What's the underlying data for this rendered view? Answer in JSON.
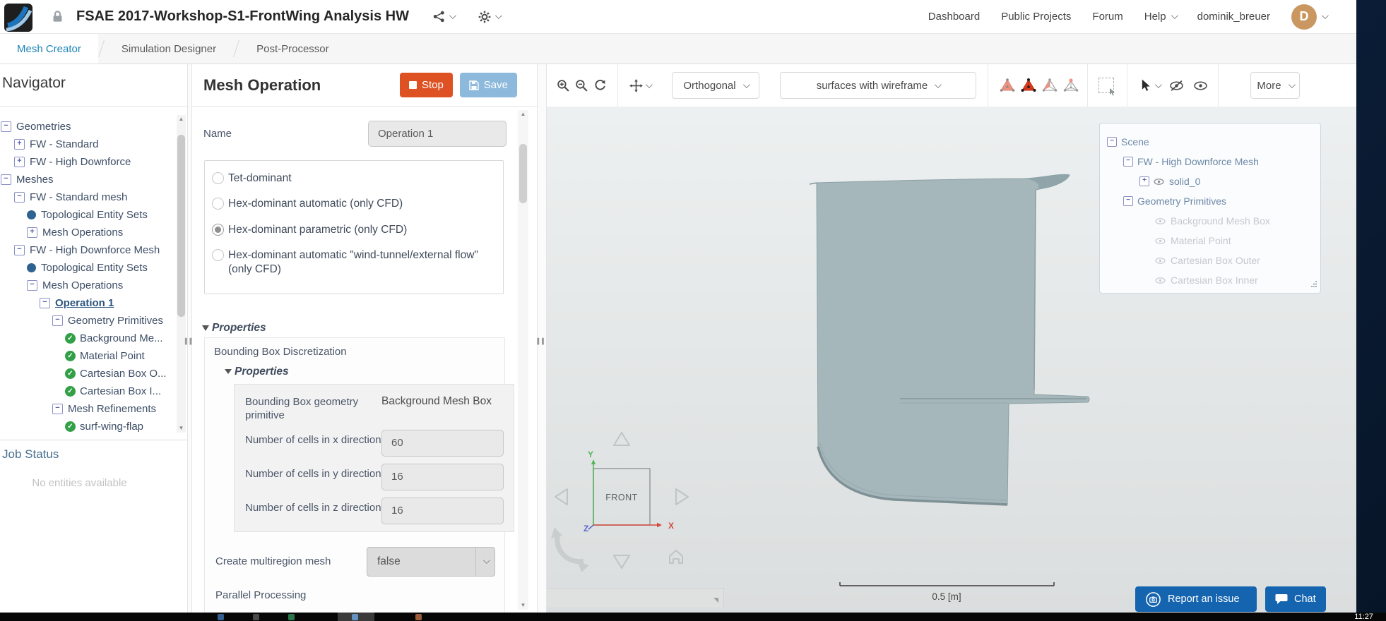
{
  "header": {
    "title": "FSAE 2017-Workshop-S1-FrontWing Analysis HW",
    "nav": [
      "Dashboard",
      "Public Projects",
      "Forum",
      "Help"
    ],
    "user": "dominik_breuer",
    "avatar_initial": "D"
  },
  "tabs": [
    "Mesh Creator",
    "Simulation Designer",
    "Post-Processor"
  ],
  "active_tab": "Mesh Creator",
  "navigator": {
    "title": "Navigator",
    "tree": [
      "Geometries",
      "FW - Standard",
      "FW - High Downforce",
      "Meshes",
      "FW - Standard mesh",
      "Topological Entity Sets",
      "Mesh Operations",
      "FW - High Downforce Mesh",
      "Topological Entity Sets",
      "Mesh Operations",
      "Operation 1",
      "Geometry Primitives",
      "Background Me...",
      "Material Point",
      "Cartesian Box O...",
      "Cartesian Box I...",
      "Mesh Refinements",
      "surf-wing-flap"
    ],
    "job_status_title": "Job Status",
    "job_status_empty": "No entities available"
  },
  "mesh_panel": {
    "title": "Mesh Operation",
    "stop_label": "Stop",
    "save_label": "Save",
    "name_label": "Name",
    "name_value": "Operation 1",
    "mesh_types": [
      "Tet-dominant",
      "Hex-dominant automatic (only CFD)",
      "Hex-dominant parametric (only CFD)",
      "Hex-dominant automatic \"wind-tunnel/external flow\" (only CFD)"
    ],
    "selected_mesh_type": "Hex-dominant parametric (only CFD)",
    "properties_label": "Properties",
    "bounding_box_group": "Bounding Box Discretization",
    "sub_properties_label": "Properties",
    "fields": [
      {
        "label": "Bounding Box geometry primitive",
        "value": "Background Mesh Box"
      },
      {
        "label": "Number of cells in x direction",
        "value": "60"
      },
      {
        "label": "Number of cells in y direction",
        "value": "16"
      },
      {
        "label": "Number of cells in z direction",
        "value": "16"
      }
    ],
    "multiregion_label": "Create multiregion mesh",
    "multiregion_value": "false",
    "parallel_label": "Parallel Processing"
  },
  "viewport": {
    "view_mode": "Orthogonal",
    "render_mode": "surfaces with wireframe",
    "more_label": "More",
    "scene_tree": [
      "Scene",
      "FW - High Downforce Mesh",
      "solid_0",
      "Geometry Primitives",
      "Background Mesh Box",
      "Material Point",
      "Cartesian Box Outer",
      "Cartesian Box Inner"
    ],
    "orientation": {
      "front": "FRONT",
      "x": "X",
      "y": "Y",
      "z": "Z"
    },
    "scale_bar": "0.5 [m]",
    "report_label": "Report an issue",
    "chat_label": "Chat"
  },
  "taskbar": {
    "clock": "11:27"
  },
  "colors": {
    "stop_button": "#dd5123",
    "save_button": "#8db9dc",
    "active_tab": "#1d84b5",
    "action_blue": "#1564af",
    "check_green": "#31a046",
    "model_fill": "#a6b7bb"
  }
}
